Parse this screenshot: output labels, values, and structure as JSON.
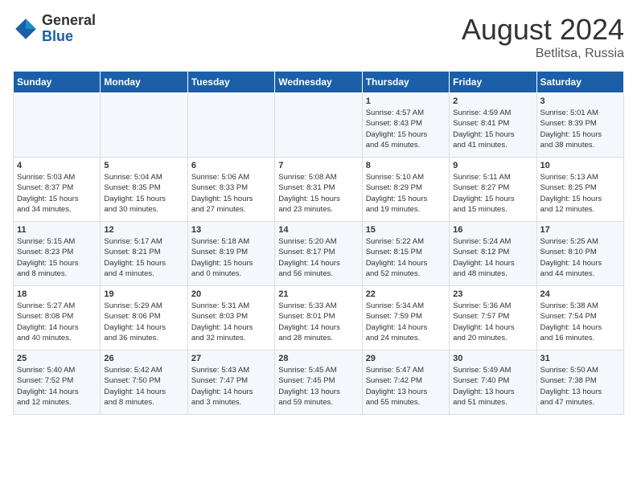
{
  "header": {
    "logo_line1": "General",
    "logo_line2": "Blue",
    "main_title": "August 2024",
    "sub_title": "Betlitsa, Russia"
  },
  "weekdays": [
    "Sunday",
    "Monday",
    "Tuesday",
    "Wednesday",
    "Thursday",
    "Friday",
    "Saturday"
  ],
  "weeks": [
    [
      {
        "day": "",
        "info": ""
      },
      {
        "day": "",
        "info": ""
      },
      {
        "day": "",
        "info": ""
      },
      {
        "day": "",
        "info": ""
      },
      {
        "day": "1",
        "info": "Sunrise: 4:57 AM\nSunset: 8:43 PM\nDaylight: 15 hours\nand 45 minutes."
      },
      {
        "day": "2",
        "info": "Sunrise: 4:59 AM\nSunset: 8:41 PM\nDaylight: 15 hours\nand 41 minutes."
      },
      {
        "day": "3",
        "info": "Sunrise: 5:01 AM\nSunset: 8:39 PM\nDaylight: 15 hours\nand 38 minutes."
      }
    ],
    [
      {
        "day": "4",
        "info": "Sunrise: 5:03 AM\nSunset: 8:37 PM\nDaylight: 15 hours\nand 34 minutes."
      },
      {
        "day": "5",
        "info": "Sunrise: 5:04 AM\nSunset: 8:35 PM\nDaylight: 15 hours\nand 30 minutes."
      },
      {
        "day": "6",
        "info": "Sunrise: 5:06 AM\nSunset: 8:33 PM\nDaylight: 15 hours\nand 27 minutes."
      },
      {
        "day": "7",
        "info": "Sunrise: 5:08 AM\nSunset: 8:31 PM\nDaylight: 15 hours\nand 23 minutes."
      },
      {
        "day": "8",
        "info": "Sunrise: 5:10 AM\nSunset: 8:29 PM\nDaylight: 15 hours\nand 19 minutes."
      },
      {
        "day": "9",
        "info": "Sunrise: 5:11 AM\nSunset: 8:27 PM\nDaylight: 15 hours\nand 15 minutes."
      },
      {
        "day": "10",
        "info": "Sunrise: 5:13 AM\nSunset: 8:25 PM\nDaylight: 15 hours\nand 12 minutes."
      }
    ],
    [
      {
        "day": "11",
        "info": "Sunrise: 5:15 AM\nSunset: 8:23 PM\nDaylight: 15 hours\nand 8 minutes."
      },
      {
        "day": "12",
        "info": "Sunrise: 5:17 AM\nSunset: 8:21 PM\nDaylight: 15 hours\nand 4 minutes."
      },
      {
        "day": "13",
        "info": "Sunrise: 5:18 AM\nSunset: 8:19 PM\nDaylight: 15 hours\nand 0 minutes."
      },
      {
        "day": "14",
        "info": "Sunrise: 5:20 AM\nSunset: 8:17 PM\nDaylight: 14 hours\nand 56 minutes."
      },
      {
        "day": "15",
        "info": "Sunrise: 5:22 AM\nSunset: 8:15 PM\nDaylight: 14 hours\nand 52 minutes."
      },
      {
        "day": "16",
        "info": "Sunrise: 5:24 AM\nSunset: 8:12 PM\nDaylight: 14 hours\nand 48 minutes."
      },
      {
        "day": "17",
        "info": "Sunrise: 5:25 AM\nSunset: 8:10 PM\nDaylight: 14 hours\nand 44 minutes."
      }
    ],
    [
      {
        "day": "18",
        "info": "Sunrise: 5:27 AM\nSunset: 8:08 PM\nDaylight: 14 hours\nand 40 minutes."
      },
      {
        "day": "19",
        "info": "Sunrise: 5:29 AM\nSunset: 8:06 PM\nDaylight: 14 hours\nand 36 minutes."
      },
      {
        "day": "20",
        "info": "Sunrise: 5:31 AM\nSunset: 8:03 PM\nDaylight: 14 hours\nand 32 minutes."
      },
      {
        "day": "21",
        "info": "Sunrise: 5:33 AM\nSunset: 8:01 PM\nDaylight: 14 hours\nand 28 minutes."
      },
      {
        "day": "22",
        "info": "Sunrise: 5:34 AM\nSunset: 7:59 PM\nDaylight: 14 hours\nand 24 minutes."
      },
      {
        "day": "23",
        "info": "Sunrise: 5:36 AM\nSunset: 7:57 PM\nDaylight: 14 hours\nand 20 minutes."
      },
      {
        "day": "24",
        "info": "Sunrise: 5:38 AM\nSunset: 7:54 PM\nDaylight: 14 hours\nand 16 minutes."
      }
    ],
    [
      {
        "day": "25",
        "info": "Sunrise: 5:40 AM\nSunset: 7:52 PM\nDaylight: 14 hours\nand 12 minutes."
      },
      {
        "day": "26",
        "info": "Sunrise: 5:42 AM\nSunset: 7:50 PM\nDaylight: 14 hours\nand 8 minutes."
      },
      {
        "day": "27",
        "info": "Sunrise: 5:43 AM\nSunset: 7:47 PM\nDaylight: 14 hours\nand 3 minutes."
      },
      {
        "day": "28",
        "info": "Sunrise: 5:45 AM\nSunset: 7:45 PM\nDaylight: 13 hours\nand 59 minutes."
      },
      {
        "day": "29",
        "info": "Sunrise: 5:47 AM\nSunset: 7:42 PM\nDaylight: 13 hours\nand 55 minutes."
      },
      {
        "day": "30",
        "info": "Sunrise: 5:49 AM\nSunset: 7:40 PM\nDaylight: 13 hours\nand 51 minutes."
      },
      {
        "day": "31",
        "info": "Sunrise: 5:50 AM\nSunset: 7:38 PM\nDaylight: 13 hours\nand 47 minutes."
      }
    ]
  ]
}
